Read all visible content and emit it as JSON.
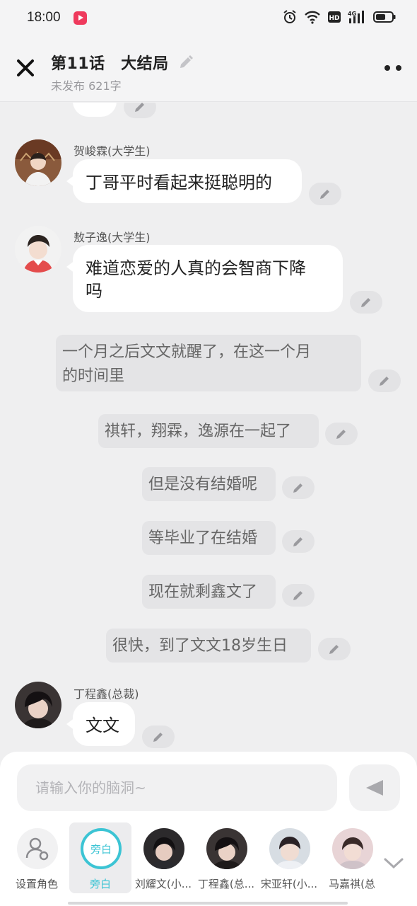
{
  "status_bar": {
    "time": "18:00"
  },
  "header": {
    "title": "第11话　大结局",
    "subtitle": "未发布 621字"
  },
  "messages": [
    {
      "type": "character",
      "name": "贺峻霖(大学生)",
      "text": "丁哥平时看起来挺聪明的"
    },
    {
      "type": "character",
      "name": "敖子逸(大学生)",
      "text_lines": [
        "难道恋爱的人真的会智商下降",
        "吗"
      ]
    },
    {
      "type": "narration",
      "text_lines": [
        "一个月之后文文就醒了，在这一个月",
        "的时间里"
      ]
    },
    {
      "type": "narration",
      "text": "祺轩，翔霖，逸源在一起了"
    },
    {
      "type": "narration",
      "text": "但是没有结婚呢"
    },
    {
      "type": "narration",
      "text": "等毕业了在结婚"
    },
    {
      "type": "narration",
      "text": "现在就剩鑫文了"
    },
    {
      "type": "narration",
      "text": "很快，到了文文18岁生日"
    },
    {
      "type": "character",
      "name": "丁程鑫(总裁)",
      "text": "文文"
    }
  ],
  "composer": {
    "placeholder": "请输入你的脑洞~"
  },
  "roles": [
    {
      "label": "设置角色"
    },
    {
      "label": "旁白",
      "badge": "旁白"
    },
    {
      "label": "刘耀文(小..."
    },
    {
      "label": "丁程鑫(总..."
    },
    {
      "label": "宋亚轩(小..."
    },
    {
      "label": "马嘉祺(总"
    }
  ],
  "colors": {
    "accent": "#3cc4d4",
    "record": "#ef3a5d",
    "background": "#efeff0"
  }
}
